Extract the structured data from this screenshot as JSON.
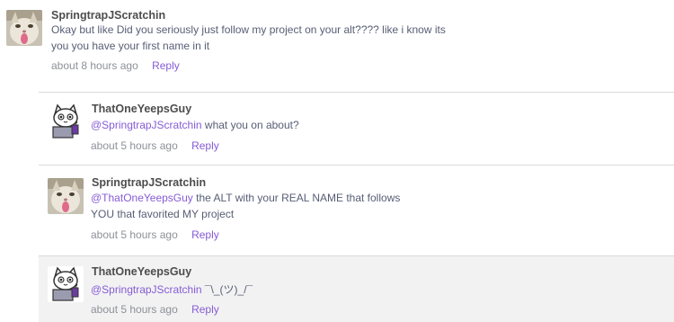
{
  "comments": [
    {
      "username": "SpringtrapJScratchin",
      "avatar": "cat-photo-avatar",
      "mention": "",
      "line1": "Okay but like Did you seriously just follow my project on your alt???? like i know its",
      "line2": "you you have your first name in it",
      "time": "about 8 hours ago",
      "reply_label": "Reply"
    },
    {
      "username": "ThatOneYeepsGuy",
      "avatar": "cartoon-cat-laptop-avatar",
      "mention": "@SpringtrapJScratchin",
      "line1": " what you on about?",
      "line2": "",
      "time": "about 5 hours ago",
      "reply_label": "Reply"
    },
    {
      "username": "SpringtrapJScratchin",
      "avatar": "cat-photo-avatar",
      "mention": "@ThatOneYeepsGuy",
      "line1": " the ALT with your REAL NAME that follows",
      "line2": "YOU that favorited MY project",
      "time": "about 5 hours ago",
      "reply_label": "Reply"
    },
    {
      "username": "ThatOneYeepsGuy",
      "avatar": "cartoon-cat-laptop-avatar",
      "mention": "@SpringtrapJScratchin",
      "line1": " ¯\\_(ツ)_/¯",
      "line2": "",
      "time": "about 5 hours ago",
      "reply_label": "Reply"
    }
  ],
  "colors": {
    "link": "#855cd6",
    "text": "#575e75",
    "meta": "#8d9198",
    "highlight": "#f2f2f2"
  }
}
